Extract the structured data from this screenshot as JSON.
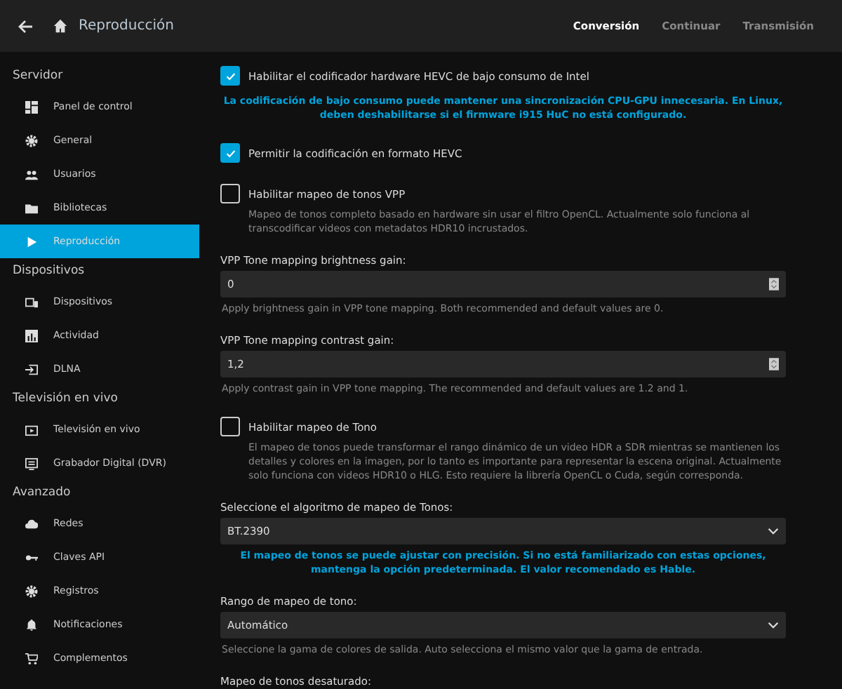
{
  "header": {
    "title": "Reproducción",
    "tabs": [
      {
        "label": "Conversión",
        "selected": true
      },
      {
        "label": "Continuar",
        "selected": false
      },
      {
        "label": "Transmisión",
        "selected": false
      }
    ]
  },
  "sidebar": {
    "sections": [
      {
        "heading": "Servidor",
        "items": [
          {
            "label": "Panel de control",
            "selected": false
          },
          {
            "label": "General",
            "selected": false
          },
          {
            "label": "Usuarios",
            "selected": false
          },
          {
            "label": "Bibliotecas",
            "selected": false
          },
          {
            "label": "Reproducción",
            "selected": true
          }
        ]
      },
      {
        "heading": "Dispositivos",
        "items": [
          {
            "label": "Dispositivos",
            "selected": false
          },
          {
            "label": "Actividad",
            "selected": false
          },
          {
            "label": "DLNA",
            "selected": false
          }
        ]
      },
      {
        "heading": "Televisión en vivo",
        "items": [
          {
            "label": "Televisión en vivo",
            "selected": false
          },
          {
            "label": "Grabador Digital (DVR)",
            "selected": false
          }
        ]
      },
      {
        "heading": "Avanzado",
        "items": [
          {
            "label": "Redes",
            "selected": false
          },
          {
            "label": "Claves API",
            "selected": false
          },
          {
            "label": "Registros",
            "selected": false
          },
          {
            "label": "Notificaciones",
            "selected": false
          },
          {
            "label": "Complementos",
            "selected": false
          }
        ]
      }
    ]
  },
  "settings": [
    {
      "kind": "checkbox",
      "label": "Habilitar el codificador hardware HEVC de bajo consumo de Intel",
      "checked": true
    },
    {
      "kind": "note",
      "text": "La codificación de bajo consumo puede mantener una sincronización CPU-GPU innecesaria. En Linux, deben deshabilitarse si el firmware i915 HuC no está configurado."
    },
    {
      "kind": "checkbox",
      "label": "Permitir la codificación en formato HEVC",
      "checked": true
    },
    {
      "kind": "checkbox",
      "label": "Habilitar mapeo de tonos VPP",
      "checked": false,
      "description": "Mapeo de tonos completo basado en hardware sin usar el filtro OpenCL. Actualmente solo funciona al transcodificar videos con metadatos HDR10 incrustados."
    },
    {
      "kind": "number",
      "label": "VPP Tone mapping brightness gain:",
      "value": "0",
      "help": "Apply brightness gain in VPP tone mapping. Both recommended and default values are 0."
    },
    {
      "kind": "number",
      "label": "VPP Tone mapping contrast gain:",
      "value": "1,2",
      "help": "Apply contrast gain in VPP tone mapping. The recommended and default values are 1.2 and 1."
    },
    {
      "kind": "checkbox",
      "label": "Habilitar mapeo de Tono",
      "checked": false,
      "description": "El mapeo de tonos puede transformar el rango dinámico de un video HDR a SDR mientras se mantienen los detalles y colores en la imagen, por lo tanto es importante para representar la escena original. Actualmente solo funciona con videos HDR10 o HLG. Esto requiere la librería OpenCL o Cuda, según corresponda."
    },
    {
      "kind": "select",
      "label": "Seleccione el algoritmo de mapeo de Tonos:",
      "value": "BT.2390",
      "note": "El mapeo de tonos se puede ajustar con precisión. Si no está familiarizado con estas opciones, mantenga la opción predeterminada. El valor recomendado es Hable."
    },
    {
      "kind": "select",
      "label": "Rango de mapeo de tono:",
      "value": "Automático",
      "help": "Seleccione la gama de colores de salida. Auto selecciona el mismo valor que la gama de entrada."
    },
    {
      "kind": "heading",
      "label": "Mapeo de tonos desaturado:"
    }
  ]
}
